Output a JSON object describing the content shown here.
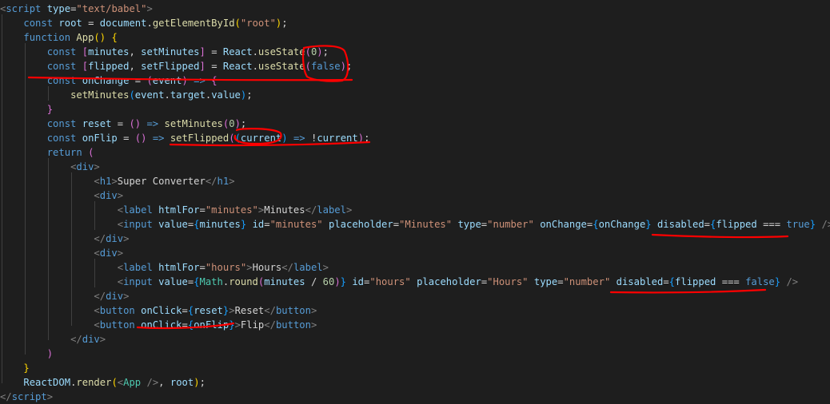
{
  "theme": {
    "background": "#1e1e1e",
    "annotation_color": "#ff0000",
    "colors": {
      "tag": "#569cd6",
      "attr": "#9cdcfe",
      "str": "#ce9178",
      "kw": "#569cd6",
      "var": "#9cdcfe",
      "fn": "#dcdcaa",
      "num": "#b5cea8",
      "txt": "#d4d4d4",
      "type": "#4ec9b0",
      "gray": "#808080",
      "brk": "#ffd700",
      "brk2": "#da70d6",
      "brk3": "#179fff"
    }
  },
  "code": {
    "lines": [
      [
        [
          "gray",
          "<"
        ],
        [
          "tag",
          "script"
        ],
        [
          "txt",
          " "
        ],
        [
          "attr",
          "type"
        ],
        [
          "txt",
          "="
        ],
        [
          "str",
          "\"text/babel\""
        ],
        [
          "gray",
          ">"
        ]
      ],
      [
        [
          "txt",
          "    "
        ],
        [
          "kw",
          "const"
        ],
        [
          "txt",
          " "
        ],
        [
          "var",
          "root"
        ],
        [
          "txt",
          " = "
        ],
        [
          "var",
          "document"
        ],
        [
          "txt",
          "."
        ],
        [
          "fn",
          "getElementById"
        ],
        [
          "brk",
          "("
        ],
        [
          "str",
          "\"root\""
        ],
        [
          "brk",
          ")"
        ],
        [
          "txt",
          ";"
        ]
      ],
      [
        [
          "txt",
          "    "
        ],
        [
          "kw",
          "function"
        ],
        [
          "txt",
          " "
        ],
        [
          "fn",
          "App"
        ],
        [
          "brk",
          "()"
        ],
        [
          "txt",
          " "
        ],
        [
          "brk",
          "{"
        ]
      ],
      [
        [
          "txt",
          "        "
        ],
        [
          "kw",
          "const"
        ],
        [
          "txt",
          " "
        ],
        [
          "brk2",
          "["
        ],
        [
          "var",
          "minutes"
        ],
        [
          "txt",
          ", "
        ],
        [
          "var",
          "setMinutes"
        ],
        [
          "brk2",
          "]"
        ],
        [
          "txt",
          " = "
        ],
        [
          "var",
          "React"
        ],
        [
          "txt",
          "."
        ],
        [
          "fn",
          "useState"
        ],
        [
          "brk2",
          "("
        ],
        [
          "num",
          "0"
        ],
        [
          "brk2",
          ")"
        ],
        [
          "txt",
          ";"
        ]
      ],
      [
        [
          "txt",
          "        "
        ],
        [
          "kw",
          "const"
        ],
        [
          "txt",
          " "
        ],
        [
          "brk2",
          "["
        ],
        [
          "var",
          "flipped"
        ],
        [
          "txt",
          ", "
        ],
        [
          "var",
          "setFlipped"
        ],
        [
          "brk2",
          "]"
        ],
        [
          "txt",
          " = "
        ],
        [
          "var",
          "React"
        ],
        [
          "txt",
          "."
        ],
        [
          "fn",
          "useState"
        ],
        [
          "brk2",
          "("
        ],
        [
          "kw",
          "false"
        ],
        [
          "brk2",
          ")"
        ],
        [
          "txt",
          ";"
        ]
      ],
      [
        [
          "txt",
          "        "
        ],
        [
          "kw",
          "const"
        ],
        [
          "txt",
          " "
        ],
        [
          "var",
          "onChange"
        ],
        [
          "txt",
          " = "
        ],
        [
          "brk2",
          "("
        ],
        [
          "var",
          "event"
        ],
        [
          "brk2",
          ")"
        ],
        [
          "txt",
          " "
        ],
        [
          "kw",
          "=>"
        ],
        [
          "txt",
          " "
        ],
        [
          "brk2",
          "{"
        ]
      ],
      [
        [
          "txt",
          "            "
        ],
        [
          "fn",
          "setMinutes"
        ],
        [
          "brk3",
          "("
        ],
        [
          "var",
          "event"
        ],
        [
          "txt",
          "."
        ],
        [
          "var",
          "target"
        ],
        [
          "txt",
          "."
        ],
        [
          "var",
          "value"
        ],
        [
          "brk3",
          ")"
        ],
        [
          "txt",
          ";"
        ]
      ],
      [
        [
          "txt",
          "        "
        ],
        [
          "brk2",
          "}"
        ]
      ],
      [
        [
          "txt",
          "        "
        ],
        [
          "kw",
          "const"
        ],
        [
          "txt",
          " "
        ],
        [
          "var",
          "reset"
        ],
        [
          "txt",
          " = "
        ],
        [
          "brk2",
          "()"
        ],
        [
          "txt",
          " "
        ],
        [
          "kw",
          "=>"
        ],
        [
          "txt",
          " "
        ],
        [
          "fn",
          "setMinutes"
        ],
        [
          "brk2",
          "("
        ],
        [
          "num",
          "0"
        ],
        [
          "brk2",
          ")"
        ],
        [
          "txt",
          ";"
        ]
      ],
      [
        [
          "txt",
          "        "
        ],
        [
          "kw",
          "const"
        ],
        [
          "txt",
          " "
        ],
        [
          "var",
          "onFlip"
        ],
        [
          "txt",
          " = "
        ],
        [
          "brk2",
          "()"
        ],
        [
          "txt",
          " "
        ],
        [
          "kw",
          "=>"
        ],
        [
          "txt",
          " "
        ],
        [
          "fn",
          "setFlipped"
        ],
        [
          "brk2",
          "("
        ],
        [
          "brk3",
          "("
        ],
        [
          "var",
          "current"
        ],
        [
          "brk3",
          ")"
        ],
        [
          "txt",
          " "
        ],
        [
          "kw",
          "=>"
        ],
        [
          "txt",
          " !"
        ],
        [
          "var",
          "current"
        ],
        [
          "brk2",
          ")"
        ],
        [
          "txt",
          ";"
        ]
      ],
      [
        [
          "txt",
          "        "
        ],
        [
          "kw",
          "return"
        ],
        [
          "txt",
          " "
        ],
        [
          "brk2",
          "("
        ]
      ],
      [
        [
          "txt",
          "            "
        ],
        [
          "gray",
          "<"
        ],
        [
          "tag",
          "div"
        ],
        [
          "gray",
          ">"
        ]
      ],
      [
        [
          "txt",
          "                "
        ],
        [
          "gray",
          "<"
        ],
        [
          "tag",
          "h1"
        ],
        [
          "gray",
          ">"
        ],
        [
          "txt",
          "Super Converter"
        ],
        [
          "gray",
          "</"
        ],
        [
          "tag",
          "h1"
        ],
        [
          "gray",
          ">"
        ]
      ],
      [
        [
          "txt",
          "                "
        ],
        [
          "gray",
          "<"
        ],
        [
          "tag",
          "div"
        ],
        [
          "gray",
          ">"
        ]
      ],
      [
        [
          "txt",
          "                    "
        ],
        [
          "gray",
          "<"
        ],
        [
          "tag",
          "label"
        ],
        [
          "txt",
          " "
        ],
        [
          "attr",
          "htmlFor"
        ],
        [
          "txt",
          "="
        ],
        [
          "str",
          "\"minutes\""
        ],
        [
          "gray",
          ">"
        ],
        [
          "txt",
          "Minutes"
        ],
        [
          "gray",
          "</"
        ],
        [
          "tag",
          "label"
        ],
        [
          "gray",
          ">"
        ]
      ],
      [
        [
          "txt",
          "                    "
        ],
        [
          "gray",
          "<"
        ],
        [
          "tag",
          "input"
        ],
        [
          "txt",
          " "
        ],
        [
          "attr",
          "value"
        ],
        [
          "txt",
          "="
        ],
        [
          "brk3",
          "{"
        ],
        [
          "var",
          "minutes"
        ],
        [
          "brk3",
          "}"
        ],
        [
          "txt",
          " "
        ],
        [
          "attr",
          "id"
        ],
        [
          "txt",
          "="
        ],
        [
          "str",
          "\"minutes\""
        ],
        [
          "txt",
          " "
        ],
        [
          "attr",
          "placeholder"
        ],
        [
          "txt",
          "="
        ],
        [
          "str",
          "\"Minutes\""
        ],
        [
          "txt",
          " "
        ],
        [
          "attr",
          "type"
        ],
        [
          "txt",
          "="
        ],
        [
          "str",
          "\"number\""
        ],
        [
          "txt",
          " "
        ],
        [
          "attr",
          "onChange"
        ],
        [
          "txt",
          "="
        ],
        [
          "brk3",
          "{"
        ],
        [
          "var",
          "onChange"
        ],
        [
          "brk3",
          "}"
        ],
        [
          "txt",
          " "
        ],
        [
          "attr",
          "disabled"
        ],
        [
          "txt",
          "="
        ],
        [
          "brk3",
          "{"
        ],
        [
          "var",
          "flipped"
        ],
        [
          "txt",
          " === "
        ],
        [
          "kw",
          "true"
        ],
        [
          "brk3",
          "}"
        ],
        [
          "txt",
          " "
        ],
        [
          "gray",
          "/>"
        ]
      ],
      [
        [
          "txt",
          "                "
        ],
        [
          "gray",
          "</"
        ],
        [
          "tag",
          "div"
        ],
        [
          "gray",
          ">"
        ]
      ],
      [
        [
          "txt",
          "                "
        ],
        [
          "gray",
          "<"
        ],
        [
          "tag",
          "div"
        ],
        [
          "gray",
          ">"
        ]
      ],
      [
        [
          "txt",
          "                    "
        ],
        [
          "gray",
          "<"
        ],
        [
          "tag",
          "label"
        ],
        [
          "txt",
          " "
        ],
        [
          "attr",
          "htmlFor"
        ],
        [
          "txt",
          "="
        ],
        [
          "str",
          "\"hours\""
        ],
        [
          "gray",
          ">"
        ],
        [
          "txt",
          "Hours"
        ],
        [
          "gray",
          "</"
        ],
        [
          "tag",
          "label"
        ],
        [
          "gray",
          ">"
        ]
      ],
      [
        [
          "txt",
          "                    "
        ],
        [
          "gray",
          "<"
        ],
        [
          "tag",
          "input"
        ],
        [
          "txt",
          " "
        ],
        [
          "attr",
          "value"
        ],
        [
          "txt",
          "="
        ],
        [
          "brk3",
          "{"
        ],
        [
          "type",
          "Math"
        ],
        [
          "txt",
          "."
        ],
        [
          "fn",
          "round"
        ],
        [
          "brk2",
          "("
        ],
        [
          "var",
          "minutes"
        ],
        [
          "txt",
          " / "
        ],
        [
          "num",
          "60"
        ],
        [
          "brk2",
          ")"
        ],
        [
          "brk3",
          "}"
        ],
        [
          "txt",
          " "
        ],
        [
          "attr",
          "id"
        ],
        [
          "txt",
          "="
        ],
        [
          "str",
          "\"hours\""
        ],
        [
          "txt",
          " "
        ],
        [
          "attr",
          "placeholder"
        ],
        [
          "txt",
          "="
        ],
        [
          "str",
          "\"Hours\""
        ],
        [
          "txt",
          " "
        ],
        [
          "attr",
          "type"
        ],
        [
          "txt",
          "="
        ],
        [
          "str",
          "\"number\""
        ],
        [
          "txt",
          " "
        ],
        [
          "attr",
          "disabled"
        ],
        [
          "txt",
          "="
        ],
        [
          "brk3",
          "{"
        ],
        [
          "var",
          "flipped"
        ],
        [
          "txt",
          " === "
        ],
        [
          "kw",
          "false"
        ],
        [
          "brk3",
          "}"
        ],
        [
          "txt",
          " "
        ],
        [
          "gray",
          "/>"
        ]
      ],
      [
        [
          "txt",
          "                "
        ],
        [
          "gray",
          "</"
        ],
        [
          "tag",
          "div"
        ],
        [
          "gray",
          ">"
        ]
      ],
      [
        [
          "txt",
          "                "
        ],
        [
          "gray",
          "<"
        ],
        [
          "tag",
          "button"
        ],
        [
          "txt",
          " "
        ],
        [
          "attr",
          "onClick"
        ],
        [
          "txt",
          "="
        ],
        [
          "brk3",
          "{"
        ],
        [
          "var",
          "reset"
        ],
        [
          "brk3",
          "}"
        ],
        [
          "gray",
          ">"
        ],
        [
          "txt",
          "Reset"
        ],
        [
          "gray",
          "</"
        ],
        [
          "tag",
          "button"
        ],
        [
          "gray",
          ">"
        ]
      ],
      [
        [
          "txt",
          "                "
        ],
        [
          "gray",
          "<"
        ],
        [
          "tag",
          "button"
        ],
        [
          "txt",
          " "
        ],
        [
          "attr",
          "onClick"
        ],
        [
          "txt",
          "="
        ],
        [
          "brk3",
          "{"
        ],
        [
          "var",
          "onFlip"
        ],
        [
          "brk3",
          "}"
        ],
        [
          "gray",
          ">"
        ],
        [
          "txt",
          "Flip"
        ],
        [
          "gray",
          "</"
        ],
        [
          "tag",
          "button"
        ],
        [
          "gray",
          ">"
        ]
      ],
      [
        [
          "txt",
          "            "
        ],
        [
          "gray",
          "</"
        ],
        [
          "tag",
          "div"
        ],
        [
          "gray",
          ">"
        ]
      ],
      [
        [
          "txt",
          "        "
        ],
        [
          "brk2",
          ")"
        ]
      ],
      [
        [
          "txt",
          "    "
        ],
        [
          "brk",
          "}"
        ]
      ],
      [
        [
          "txt",
          "    "
        ],
        [
          "var",
          "ReactDOM"
        ],
        [
          "txt",
          "."
        ],
        [
          "fn",
          "render"
        ],
        [
          "brk",
          "("
        ],
        [
          "gray",
          "<"
        ],
        [
          "type",
          "App"
        ],
        [
          "txt",
          " "
        ],
        [
          "gray",
          "/>"
        ],
        [
          "txt",
          ", "
        ],
        [
          "var",
          "root"
        ],
        [
          "brk",
          ")"
        ],
        [
          "txt",
          ";"
        ]
      ],
      [
        [
          "gray",
          "</"
        ],
        [
          "tag",
          "script"
        ],
        [
          "gray",
          ">"
        ]
      ]
    ]
  }
}
